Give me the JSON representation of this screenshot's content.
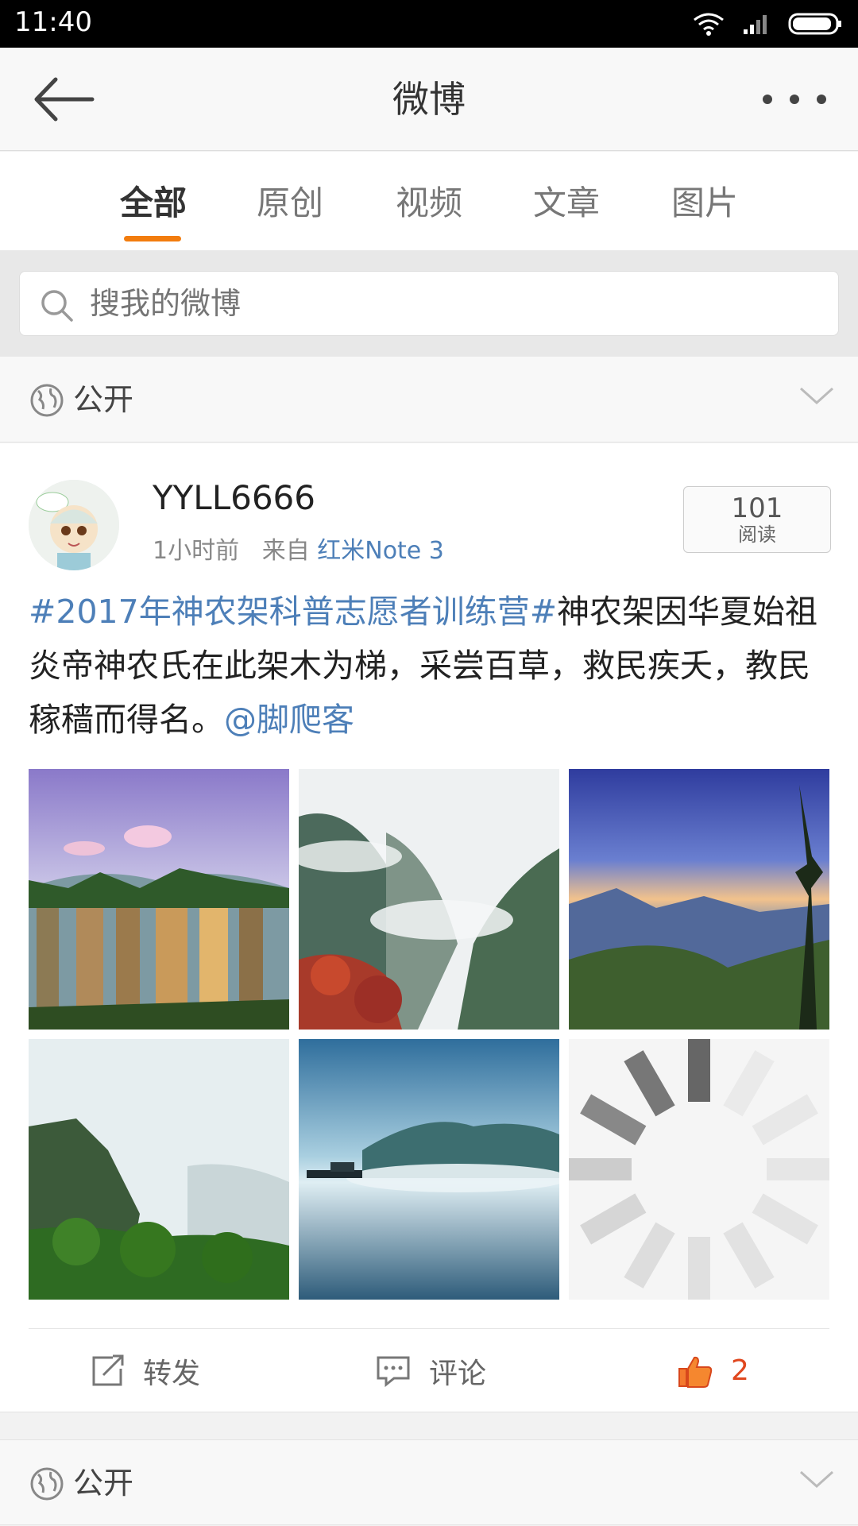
{
  "status_bar": {
    "time": "11:40"
  },
  "nav": {
    "title": "微博"
  },
  "tabs": [
    {
      "label": "全部",
      "active": true
    },
    {
      "label": "原创",
      "active": false
    },
    {
      "label": "视频",
      "active": false
    },
    {
      "label": "文章",
      "active": false
    },
    {
      "label": "图片",
      "active": false
    }
  ],
  "search": {
    "placeholder": "搜我的微博"
  },
  "visibility": {
    "label": "公开"
  },
  "post": {
    "username": "YYLL6666",
    "time": "1小时前",
    "from_prefix": "来自",
    "source": "红米Note 3",
    "read_count": "101",
    "read_label": "阅读",
    "text_topic": "#2017年神农架科普志愿者训练营#",
    "text_body": "神农架因华夏始祖 炎帝神农氏在此架木为梯，采尝百草，救民疾夭，教民稼穑而得名。",
    "text_mention": "@脚爬客",
    "photos": [
      "zhangjiajie-peaks",
      "misty-valley-red-trees",
      "sunset-mountains",
      "misty-cliff",
      "misty-lake-boat",
      "loading"
    ],
    "actions": {
      "repost": "转发",
      "comment": "评论",
      "like_count": "2"
    }
  },
  "next_visibility": {
    "label": "公开"
  },
  "colors": {
    "accent": "#f27c0e",
    "link": "#4d7fb8",
    "like": "#e0471e"
  }
}
